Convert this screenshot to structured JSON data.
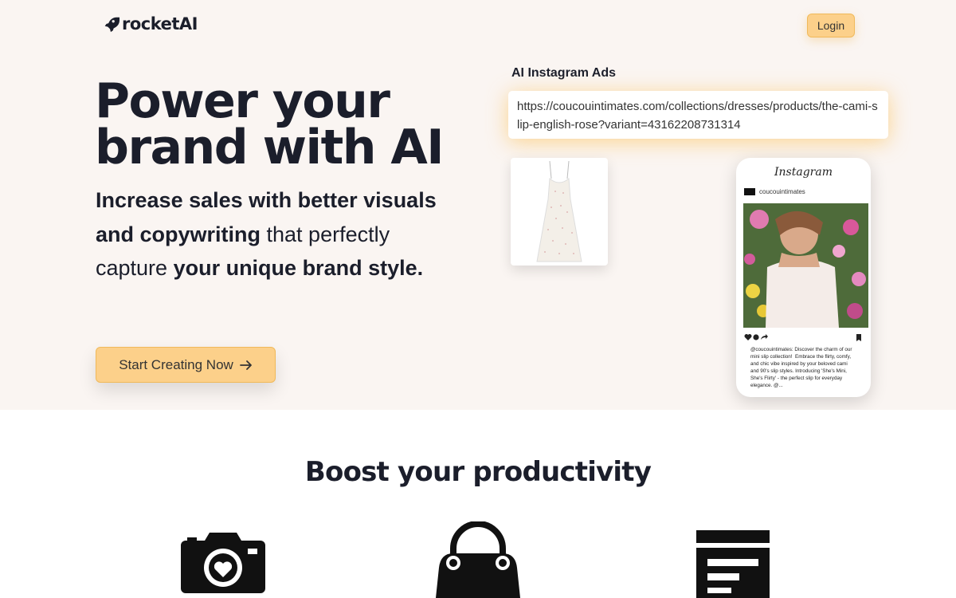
{
  "header": {
    "logo_text": "rocketAI",
    "logo_icon": "rocket-icon",
    "login_label": "Login"
  },
  "hero": {
    "headline_line1": "Power your",
    "headline_line2": "brand with AI",
    "sub_1": "Increase sales with better visuals and copywriting",
    "sub_2": " that perfectly capture ",
    "sub_3": "your unique brand style.",
    "cta_label": "Start Creating Now",
    "cta_icon": "arrow-right-icon"
  },
  "demo": {
    "title": "AI Instagram Ads",
    "url_value": "https://coucouintimates.com/collections/dresses/products/the-cami-slip-english-rose?variant=43162208731314",
    "instagram_logo": "Instagram",
    "account_name": "coucouintimates",
    "caption": "@coucouintimates: Discover the charm of our mini slip collection! ⁣⁣ Embrace the flirty, comfy, and chic vibe inspired by your beloved cami and 90's slip styles. Introducing 'She's Mini, She's Flirty' - the perfect slip for everyday elegance. @..."
  },
  "features": {
    "title": "Boost your productivity",
    "icons": [
      "camera-heart-icon",
      "shopping-bag-icon",
      "document-lines-icon"
    ]
  },
  "colors": {
    "hero_bg": "#faf5f2",
    "accent": "#fcd08a",
    "text": "#1b1e2b"
  }
}
